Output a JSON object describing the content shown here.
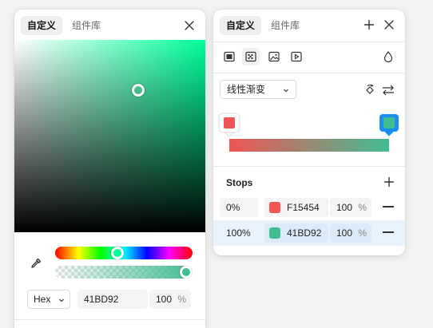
{
  "left_panel": {
    "tabs": [
      {
        "label": "自定义",
        "active": true
      },
      {
        "label": "组件库",
        "active": false
      }
    ],
    "picker": {
      "hue_color": "#00ff9a",
      "current_color": "#41bd92"
    },
    "format_select": {
      "value": "Hex"
    },
    "hex_value": "41BD92",
    "opacity_value": "100",
    "percent_sign": "%"
  },
  "right_panel": {
    "tabs": [
      {
        "label": "自定义",
        "active": true
      },
      {
        "label": "组件库",
        "active": false
      }
    ],
    "fill_types": [
      "solid-fill-icon",
      "gradient-fill-icon",
      "image-fill-icon",
      "video-fill-icon"
    ],
    "gradient_type": {
      "value": "线性渐变"
    },
    "stops_title": "Stops",
    "stops": [
      {
        "position": "0%",
        "hex": "F15454",
        "color": "#f15454",
        "opacity": "100",
        "selected": false
      },
      {
        "position": "100%",
        "hex": "41BD92",
        "color": "#41bd92",
        "opacity": "100",
        "selected": true
      }
    ],
    "percent_sign": "%"
  },
  "colors": {
    "accent": "#1b8ff0",
    "selected_row": "#e9f3fd",
    "stop_a": "#f15454",
    "stop_b": "#41bd92"
  }
}
